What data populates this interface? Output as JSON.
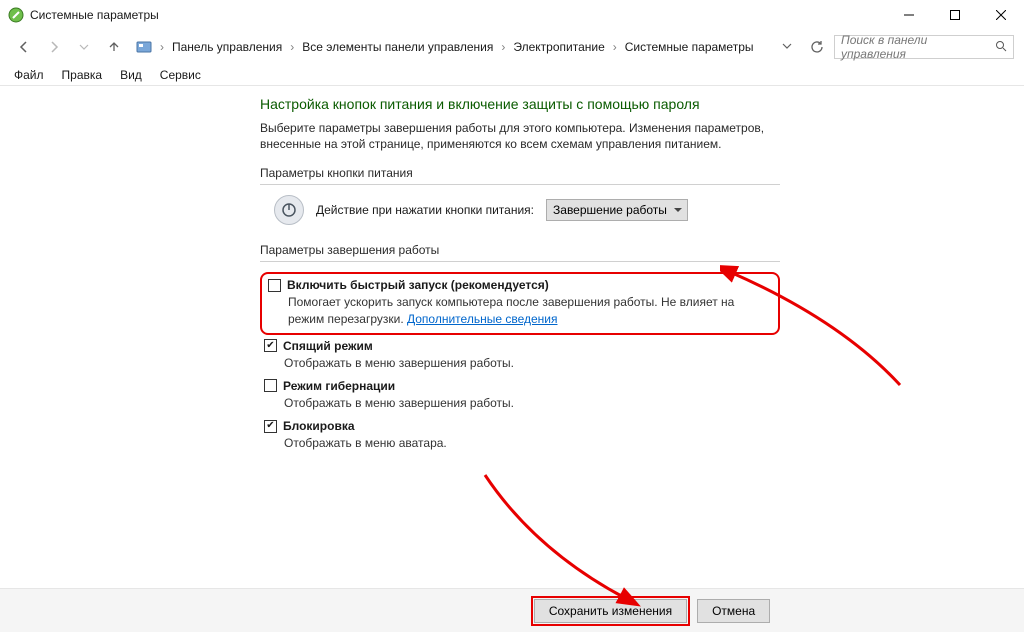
{
  "window": {
    "title": "Системные параметры"
  },
  "breadcrumb": {
    "items": [
      "Панель управления",
      "Все элементы панели управления",
      "Электропитание",
      "Системные параметры"
    ]
  },
  "search": {
    "placeholder": "Поиск в панели управления"
  },
  "menu": {
    "items": [
      "Файл",
      "Правка",
      "Вид",
      "Сервис"
    ]
  },
  "page": {
    "heading": "Настройка кнопок питания и включение защиты с помощью пароля",
    "lead": "Выберите параметры завершения работы для этого компьютера. Изменения параметров, внесенные на этой странице, применяются ко всем схемам управления питанием.",
    "group1_label": "Параметры кнопки питания",
    "power_button_label": "Действие при нажатии кнопки питания:",
    "power_button_action": "Завершение работы",
    "group2_label": "Параметры завершения работы",
    "options": {
      "fast_start": {
        "label": "Включить быстрый запуск (рекомендуется)",
        "desc_prefix": "Помогает ускорить запуск компьютера после завершения работы. Не влияет на режим перезагрузки. ",
        "link": "Дополнительные сведения",
        "checked": false
      },
      "sleep": {
        "label": "Спящий режим",
        "desc": "Отображать в меню завершения работы.",
        "checked": true
      },
      "hibernate": {
        "label": "Режим гибернации",
        "desc": "Отображать в меню завершения работы.",
        "checked": false
      },
      "lock": {
        "label": "Блокировка",
        "desc": "Отображать в меню аватара.",
        "checked": true
      }
    }
  },
  "footer": {
    "save": "Сохранить изменения",
    "cancel": "Отмена"
  }
}
